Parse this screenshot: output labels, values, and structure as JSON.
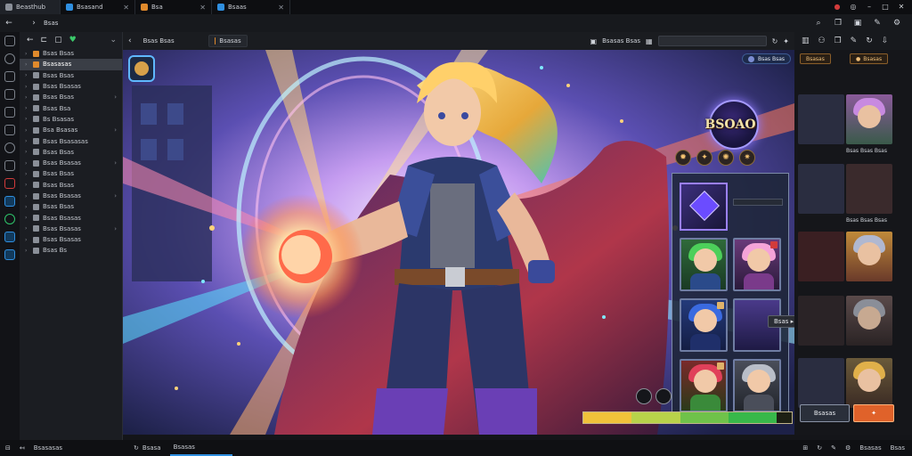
{
  "titlebar": {
    "tabs": [
      {
        "label": "Beasthub",
        "color": "#8a8f98"
      },
      {
        "label": "Bsasand",
        "color": "#2f8fe0"
      },
      {
        "label": "Bsa",
        "color": "#e08a2c"
      },
      {
        "label": "Bsaas",
        "color": "#2f8fe0"
      }
    ],
    "window_controls": [
      "–",
      "□",
      "✕"
    ]
  },
  "toolbar": {
    "back_label": "Bsas"
  },
  "explorer": {
    "items": [
      {
        "label": "Bsas Bsas",
        "icon": "orange"
      },
      {
        "label": "Bsasasas",
        "icon": "orange",
        "selected": true
      },
      {
        "label": "Bsas Bsas"
      },
      {
        "label": "Bsas Bsasas"
      },
      {
        "label": "Bsas Bsas"
      },
      {
        "label": "Bsas Bsa"
      },
      {
        "label": "Bs Bsasas"
      },
      {
        "label": "Bsa Bsasas"
      },
      {
        "label": "Bsas Bsasasas"
      },
      {
        "label": "Bsas Bsas"
      },
      {
        "label": "Bsas Bsasas"
      },
      {
        "label": "Bsas Bsas"
      },
      {
        "label": "Bsas Bsas"
      },
      {
        "label": "Bsas Bsasas"
      },
      {
        "label": "Bsas Bsas"
      },
      {
        "label": "Bsas Bsasas"
      },
      {
        "label": "Bsas Bsasas"
      },
      {
        "label": "Bsas Bsasas"
      },
      {
        "label": "Bsas Bs"
      }
    ]
  },
  "editor": {
    "tabs": [
      {
        "label": "Bsas Bsas"
      },
      {
        "label": "Bsasas"
      }
    ],
    "right_label": "Bsasas Bsas"
  },
  "game": {
    "logo_text": "BSOAO",
    "top_pill": "Bsas Bsas",
    "tip_label": "Bsas",
    "hp_fill": 0.92,
    "hp_colors": [
      "#f0c23a",
      "#b8d24a",
      "#6fc24a",
      "#38b84a"
    ]
  },
  "right_panel": {
    "tags": [
      "Bsasas",
      "Bsasas"
    ],
    "captions": [
      "Bsas Bsas Bsas",
      "Bsas Bsas Bsas"
    ],
    "buttons": [
      "Bsasas",
      "✦"
    ]
  },
  "statusbar": {
    "items": [
      "Bsasasas",
      "Bsasa",
      "Bsasas"
    ],
    "right": [
      "⊞",
      "↻",
      "✎",
      "⚙",
      "Bsasas",
      "Bsas"
    ]
  }
}
